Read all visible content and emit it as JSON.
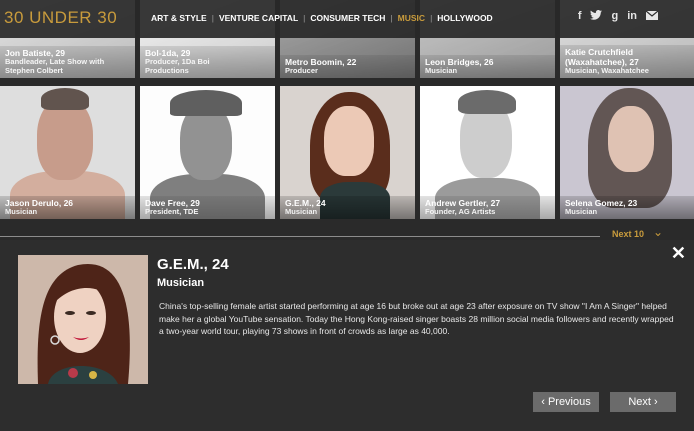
{
  "header": {
    "logo": "30 UNDER 30",
    "nav": [
      "ART & STYLE",
      "VENTURE CAPITAL",
      "CONSUMER TECH",
      "MUSIC",
      "HOLLYWOOD"
    ],
    "active_nav": "MUSIC",
    "social": [
      "f",
      "t",
      "g+",
      "in",
      "mail"
    ]
  },
  "grid": {
    "row1": [
      {
        "name": "Jon Batiste, 29",
        "role": "Bandleader, Late Show with Stephen Colbert"
      },
      {
        "name": "Bol-1da, 29",
        "role": "Producer, 1Da Boi Productions"
      },
      {
        "name": "Metro Boomin, 22",
        "role": "Producer"
      },
      {
        "name": "Leon Bridges, 26",
        "role": "Musician"
      },
      {
        "name": "Katie Crutchfield (Waxahatchee), 27",
        "role": "Musician, Waxahatchee"
      }
    ],
    "row2": [
      {
        "name": "Jason Derulo, 26",
        "role": "Musician"
      },
      {
        "name": "Dave Free, 29",
        "role": "President, TDE"
      },
      {
        "name": "G.E.M., 24",
        "role": "Musician"
      },
      {
        "name": "Andrew Gertler, 27",
        "role": "Founder, AG Artists"
      },
      {
        "name": "Selena Gomez, 23",
        "role": "Musician"
      }
    ],
    "next_label": "Next 10"
  },
  "detail": {
    "title": "G.E.M., 24",
    "role": "Musician",
    "description": "China's top-selling female artist started performing at age 16 but broke out at age 23 after exposure on TV show \"I Am A Singer\" helped make her a global YouTube sensation. Today the Hong Kong-raised singer boasts 28 million social media followers and recently wrapped a two-year world tour, playing 73 shows in front of crowds as large as 40,000.",
    "prev_label": "Previous",
    "next_label": "Next"
  },
  "colors": {
    "accent": "#c89b3c",
    "panel": "#2d2d2d",
    "button": "#6b6b6b"
  }
}
